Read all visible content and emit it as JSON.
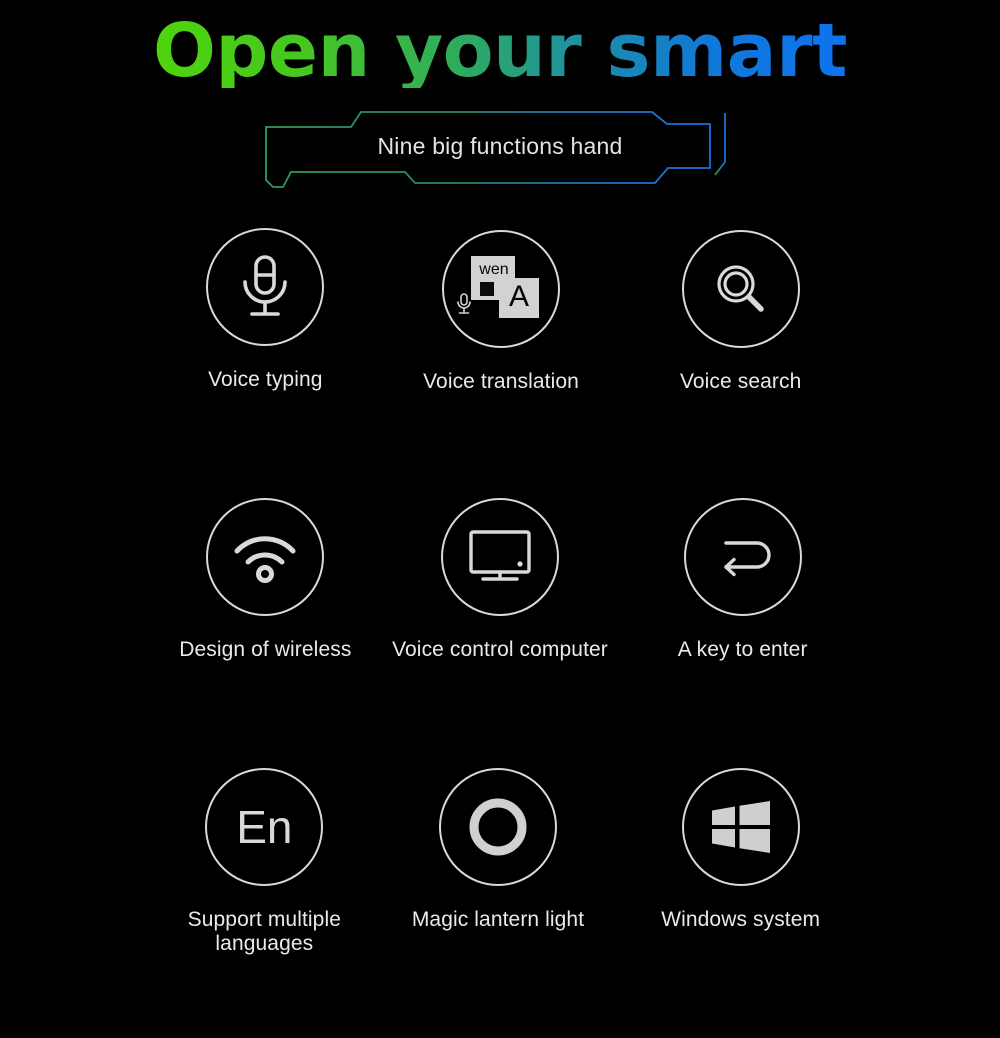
{
  "header": {
    "title": "Open your smart",
    "title_gradient_from": "#4fd40c",
    "title_gradient_to": "#0d74f0",
    "subtitle": "Nine big functions hand",
    "banner_frame_from": "#2f9e5c",
    "banner_frame_to": "#1b6fe0"
  },
  "theme": {
    "background": "#000000",
    "icon_stroke": "#d9d9d9",
    "label_color": "#eaeaea"
  },
  "features": [
    {
      "label": "Voice typing",
      "icon": "microphone-icon"
    },
    {
      "label": "Voice translation",
      "icon": "translation-icon",
      "glyph_back": "wen",
      "glyph_front": "A"
    },
    {
      "label": "Voice search",
      "icon": "magnifier-icon"
    },
    {
      "label": "Design of wireless",
      "icon": "wifi-icon"
    },
    {
      "label": "Voice control computer",
      "icon": "monitor-icon"
    },
    {
      "label": "A key to enter",
      "icon": "enter-key-icon"
    },
    {
      "label": "Support multiple languages",
      "icon": "en-text-icon",
      "glyph": "En"
    },
    {
      "label": "Magic lantern light",
      "icon": "ring-light-icon"
    },
    {
      "label": "Windows system",
      "icon": "windows-logo-icon"
    }
  ]
}
